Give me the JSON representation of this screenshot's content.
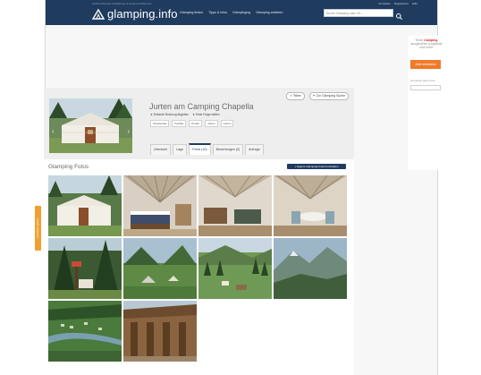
{
  "nav": {
    "tagline": "Authentisches Glamping & Ferienerlebnisse",
    "util_links": [
      "Anmelden",
      "Registrieren",
      "Hilfe"
    ],
    "logo_text": "glamping.info",
    "links": [
      "Glamping finden",
      "Tipps & Infos",
      "Glampinglog",
      "Glamping anbieten"
    ],
    "search_placeholder": "Suche Glamping oder Ort…",
    "search_icon": "search-icon"
  },
  "listing": {
    "title": "Jurten am Camping Chapella",
    "meta": [
      "★ Einfache Buchung Abgeben",
      "★ Erste Frage stellen"
    ],
    "tags": [
      "Outdoorlab",
      "Familie",
      "Kinder",
      "Jurten",
      "Leben"
    ],
    "share_label": "Teilen",
    "watch_label": "Zur Glamping Suche",
    "tabs": [
      "Übersicht",
      "Lage",
      "Fotos (10)",
      "Bewertungen (0)",
      "Anfrage"
    ],
    "active_tab": "Fotos (10)"
  },
  "gallery": {
    "heading": "Glamping Fotos",
    "add_button": "+ Eigene Glamping-Fotos hochladen",
    "photos": [
      "yurt-exterior",
      "yurt-interior-bed",
      "yurt-interior-sofa",
      "yurt-interior-table",
      "forest-with-yurt",
      "meadow-with-tents",
      "campground-valley",
      "mountain-view",
      "aerial-campsite",
      "wooden-building"
    ]
  },
  "feedback": {
    "label": "Feedback geben"
  },
  "sidebar": {
    "brand_prefix": "Teste",
    "brand_highlight": "Camping",
    "brand_suffix": "ausgleichen Angebote und mehr",
    "button": "Jetzt entdecken",
    "small_text": "Newsletter abonnieren"
  }
}
